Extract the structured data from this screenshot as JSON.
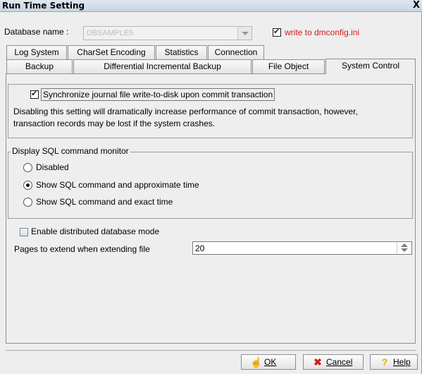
{
  "window": {
    "title": "Run Time Setting",
    "close_glyph": "X"
  },
  "database": {
    "label": "Database name :",
    "value": "DBSAMPLE5"
  },
  "write_config": {
    "label": "write to dmconfig.ini",
    "checked": true,
    "color": "#d51a1a"
  },
  "tabs_top": [
    {
      "label": "Log System"
    },
    {
      "label": "CharSet Encoding"
    },
    {
      "label": "Statistics"
    },
    {
      "label": "Connection"
    }
  ],
  "tabs_bottom": [
    {
      "label": "Backup"
    },
    {
      "label": "Differential Incremental Backup"
    },
    {
      "label": "File Object"
    },
    {
      "label": "System Control",
      "active": true
    }
  ],
  "sync": {
    "label": "Synchronize journal file write-to-disk upon commit transaction",
    "checked": true,
    "description_line1": "Disabling this setting will dramatically increase performance of commit transaction, however,",
    "description_line2": "transaction records may be lost if the system crashes."
  },
  "sql_monitor": {
    "title": "Display SQL command monitor",
    "options": [
      {
        "label": "Disabled",
        "selected": false
      },
      {
        "label": "Show SQL command and approximate time",
        "selected": true
      },
      {
        "label": "Show SQL command and exact time",
        "selected": false
      }
    ]
  },
  "distributed": {
    "label": "Enable distributed database mode",
    "checked": false
  },
  "pages_extend": {
    "label": "Pages to extend when extending file",
    "value": "20"
  },
  "buttons": {
    "ok": "OK",
    "cancel": "Cancel",
    "help": "Help"
  }
}
